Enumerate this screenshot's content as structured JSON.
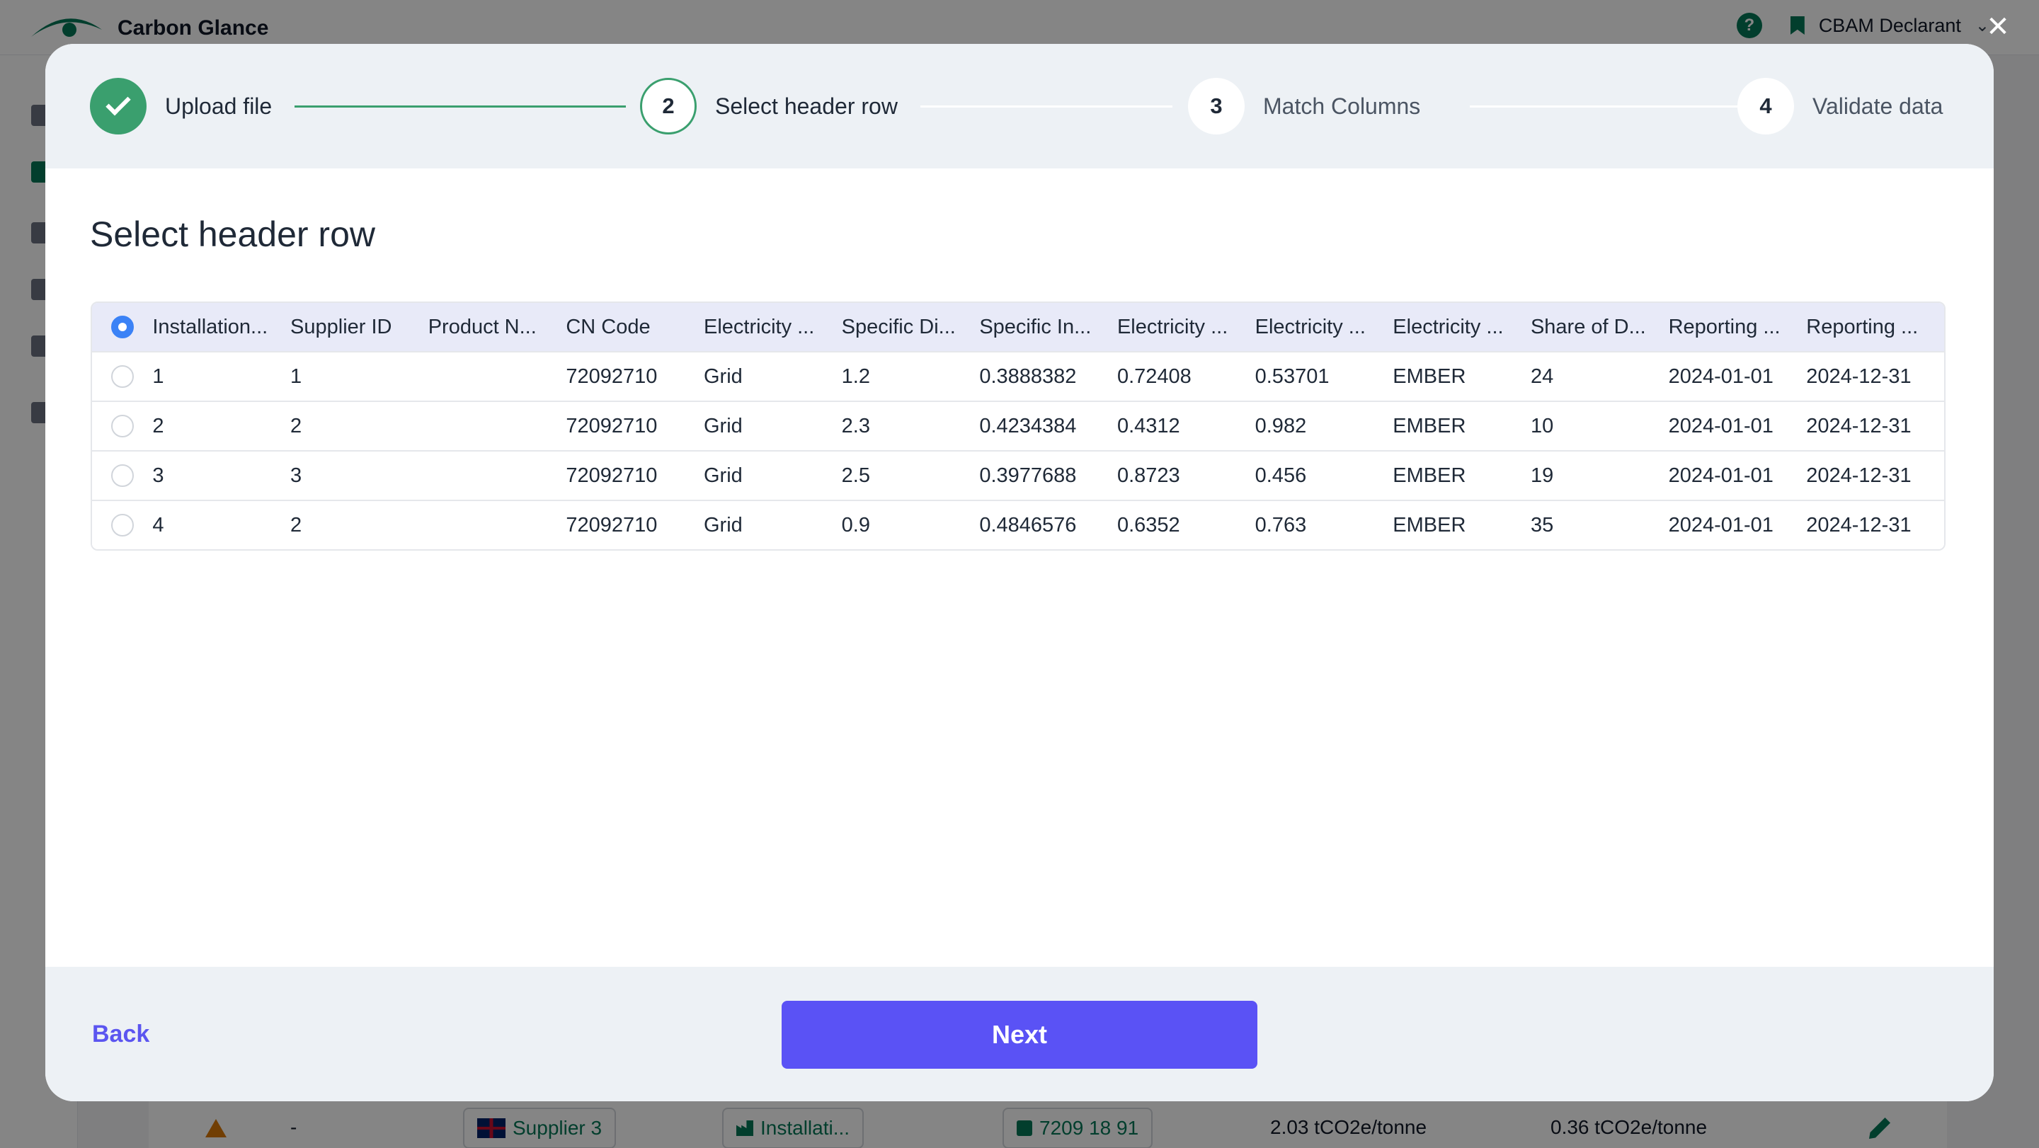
{
  "app": {
    "brand": "Carbon Glance",
    "help_glyph": "?",
    "role": "CBAM Declarant"
  },
  "background_row": {
    "dash": "-",
    "supplier": "Supplier 3",
    "installation": "Installati...",
    "cn_code": "7209 18 91",
    "value_a": "2.03 tCO2e/tonne",
    "value_b": "0.36 tCO2e/tonne"
  },
  "modal": {
    "close_glyph": "✕",
    "steps": [
      {
        "number": "1",
        "label": "Upload file",
        "state": "done"
      },
      {
        "number": "2",
        "label": "Select header row",
        "state": "current"
      },
      {
        "number": "3",
        "label": "Match Columns",
        "state": "todo"
      },
      {
        "number": "4",
        "label": "Validate data",
        "state": "todo"
      }
    ],
    "title": "Select header row",
    "table": {
      "selected_row": 0,
      "rows": [
        [
          "Installation...",
          "Supplier ID",
          "Product N...",
          "CN Code",
          "Electricity ...",
          "Specific Di...",
          "Specific In...",
          "Electricity ...",
          "Electricity ...",
          "Electricity ...",
          "Share of D...",
          "Reporting ...",
          "Reporting ..."
        ],
        [
          "1",
          "1",
          "",
          "72092710",
          "Grid",
          "1.2",
          "0.3888382",
          "0.72408",
          "0.53701",
          "EMBER",
          "24",
          "2024-01-01",
          "2024-12-31"
        ],
        [
          "2",
          "2",
          "",
          "72092710",
          "Grid",
          "2.3",
          "0.4234384",
          "0.4312",
          "0.982",
          "EMBER",
          "10",
          "2024-01-01",
          "2024-12-31"
        ],
        [
          "3",
          "3",
          "",
          "72092710",
          "Grid",
          "2.5",
          "0.3977688",
          "0.8723",
          "0.456",
          "EMBER",
          "19",
          "2024-01-01",
          "2024-12-31"
        ],
        [
          "4",
          "2",
          "",
          "72092710",
          "Grid",
          "0.9",
          "0.4846576",
          "0.6352",
          "0.763",
          "EMBER",
          "35",
          "2024-01-01",
          "2024-12-31"
        ]
      ]
    },
    "footer": {
      "back_label": "Back",
      "next_label": "Next"
    }
  },
  "colors": {
    "accent": "#5a52f5",
    "success": "#3a9f6e",
    "radio_selected": "#3b82f6"
  }
}
